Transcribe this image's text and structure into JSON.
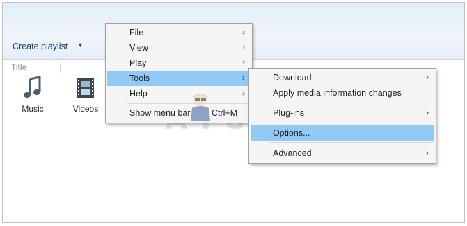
{
  "toolbar": {
    "create_playlist_label": "Create playlist",
    "dropdown_caret": "▼"
  },
  "columns": {
    "title_label": "Title"
  },
  "library": [
    {
      "label": "Music",
      "icon": "music-note-icon"
    },
    {
      "label": "Videos",
      "icon": "film-strip-icon"
    }
  ],
  "main_menu": {
    "items": [
      {
        "label": "File",
        "has_submenu": true
      },
      {
        "label": "View",
        "has_submenu": true
      },
      {
        "label": "Play",
        "has_submenu": true
      },
      {
        "label": "Tools",
        "has_submenu": true,
        "highlighted": true
      },
      {
        "label": "Help",
        "has_submenu": true
      },
      {
        "label": "Show menu bar",
        "shortcut": "Ctrl+M"
      }
    ],
    "arrow_glyph": "›"
  },
  "tools_submenu": {
    "items": [
      {
        "label": "Download",
        "has_submenu": true
      },
      {
        "label": "Apply media information changes"
      },
      {
        "label": "Plug-ins",
        "has_submenu": true
      },
      {
        "label": "Options...",
        "highlighted": true
      },
      {
        "label": "Advanced",
        "has_submenu": true
      }
    ]
  },
  "watermark": {
    "text": "A  PUALS"
  },
  "colors": {
    "menu_highlight": "#91c9f7",
    "menu_background": "#f5f5f5",
    "toolbar_text": "#1e395b"
  }
}
